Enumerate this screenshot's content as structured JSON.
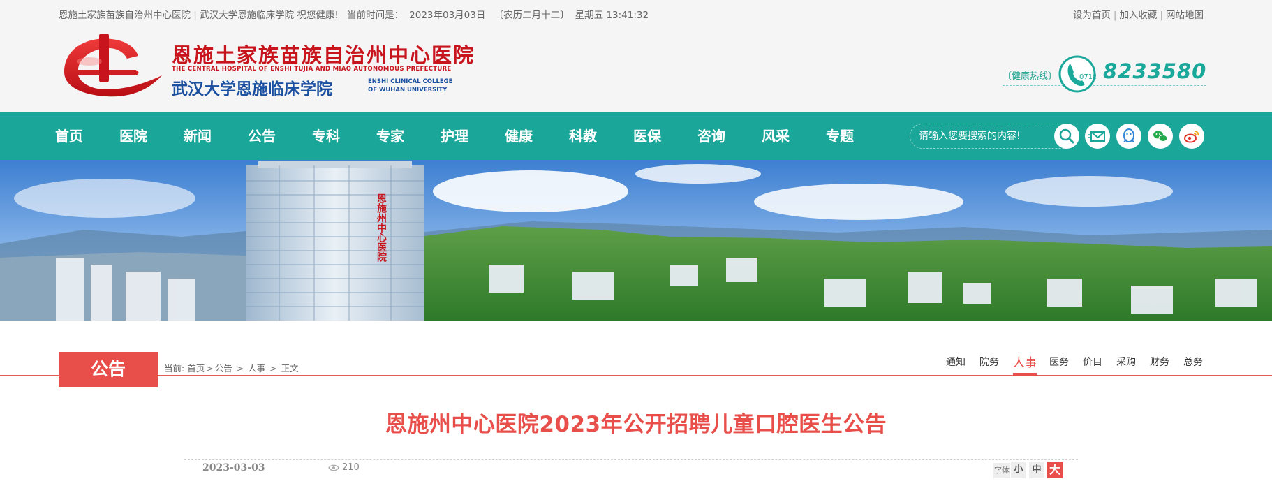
{
  "topbar": {
    "welcome": "恩施土家族苗族自治州中心医院 | 武汉大学恩施临床学院 祝您健康!",
    "time_label": "当前时间是：",
    "date": "2023年03月03日",
    "lunar": "〔农历二月十二〕",
    "weekday_time": "星期五 13:41:32",
    "links": [
      "设为首页",
      "加入收藏",
      "网站地图"
    ]
  },
  "logo": {
    "cn_name": "恩施土家族苗族自治州中心医院",
    "en_name": "THE CENTRAL HOSPITAL OF ENSHI TUJIA AND MIAO AUTONOMOUS PREFECTURE",
    "sub_name": "武汉大学恩施临床学院",
    "sub_en_line1": "ENSHI CLINICAL COLLEGE",
    "sub_en_line2": "OF WUHAN UNIVERSITY"
  },
  "hotline": {
    "label": "〔健康热线〕",
    "area_code": "0718",
    "number": "8233580"
  },
  "nav": {
    "items": [
      "首页",
      "医院",
      "新闻",
      "公告",
      "专科",
      "专家",
      "护理",
      "健康",
      "科教",
      "医保",
      "咨询",
      "风采",
      "专题"
    ]
  },
  "search": {
    "placeholder": "请输入您要搜索的内容!"
  },
  "icons": [
    "search-icon",
    "mail-icon",
    "qq-icon",
    "wechat-icon",
    "weibo-icon"
  ],
  "banner": {
    "building_sign": "恩施州中心医院"
  },
  "section": {
    "tag": "公告",
    "breadcrumb_label": "当前:",
    "breadcrumb": [
      "首页",
      "公告",
      "人事",
      "正文"
    ]
  },
  "subnav": {
    "items": [
      "通知",
      "院务",
      "人事",
      "医务",
      "价目",
      "采购",
      "财务",
      "总务"
    ],
    "active": "人事"
  },
  "article": {
    "title": "恩施州中心医院2023年公开招聘儿童口腔医生公告",
    "date": "2023-03-03",
    "views": "210",
    "font_label": "字体",
    "font_sizes": [
      "小",
      "中",
      "大"
    ],
    "active_font_size": "大"
  },
  "colors": {
    "teal": "#1aa698",
    "red": "#e94f4a",
    "logo_red": "#c8151d",
    "logo_blue": "#1b4fa0"
  }
}
